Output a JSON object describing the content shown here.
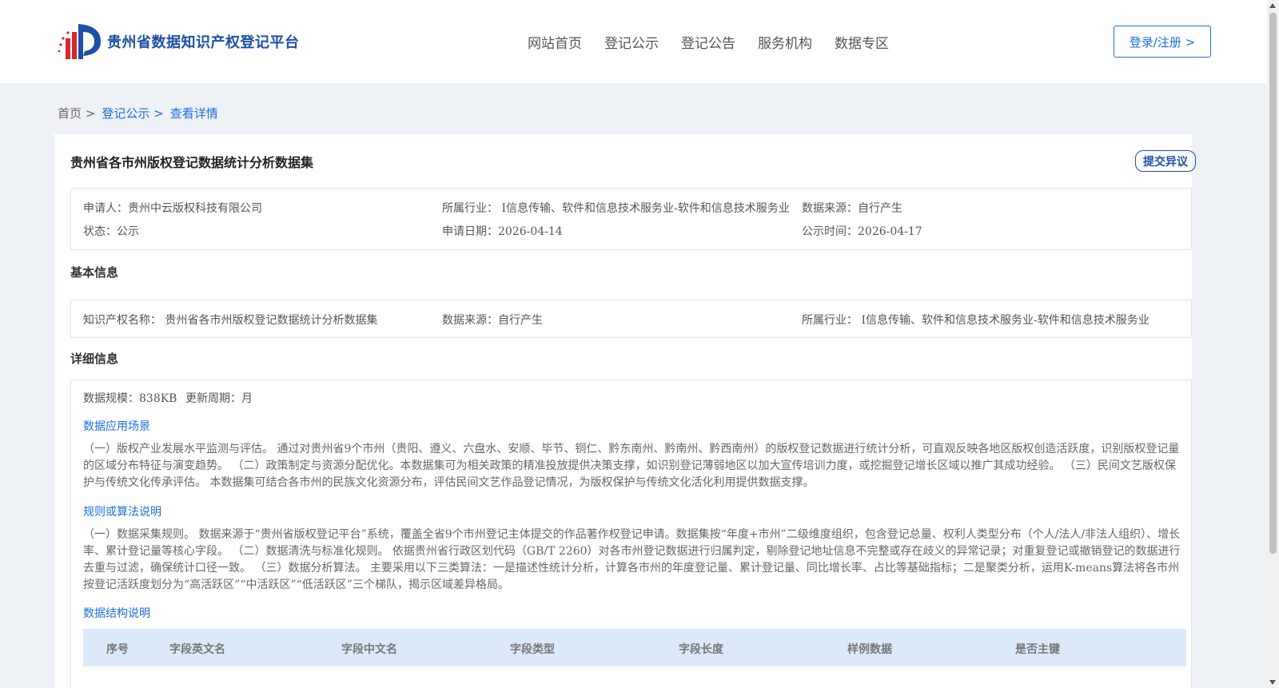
{
  "header": {
    "site_name": "贵州省数据知识产权登记平台",
    "nav": [
      "网站首页",
      "登记公示",
      "登记公告",
      "服务机构",
      "数据专区"
    ],
    "login_label": "登录/注册 >"
  },
  "breadcrumb": {
    "home": "首页 >",
    "level1": "登记公示 >",
    "level2": "查看详情"
  },
  "detail": {
    "title": "贵州省各市州版权登记数据统计分析数据集",
    "objection_label": "提交异议",
    "summary": {
      "applicant": "申请人：贵州中云版权科技有限公司",
      "industry": "所属行业： I信息传输、软件和信息技术服务业-软件和信息技术服务业",
      "source": "数据来源：自行产生",
      "status": "状态：公示",
      "apply_date": "申请日期：2026-04-14",
      "publish_date": "公示时间：2026-04-17"
    },
    "basic": {
      "section_title": "基本信息",
      "name": "知识产权名称： 贵州省各市州版权登记数据统计分析数据集",
      "source": "数据来源：自行产生",
      "industry": "所属行业： I信息传输、软件和信息技术服务业-软件和信息技术服务业"
    },
    "details": {
      "section_title": "详细信息",
      "scale": "数据规模：838KB",
      "cycle": "更新周期：月",
      "scenario_title": "数据应用场景",
      "scenario_text": "（一）版权产业发展水平监测与评估。 通过对贵州省9个市州（贵阳、遵义、六盘水、安顺、毕节、铜仁、黔东南州、黔南州、黔西南州）的版权登记数据进行统计分析，可直观反映各地区版权创造活跃度，识别版权登记量的区域分布特征与演变趋势。 （二）政策制定与资源分配优化。本数据集可为相关政策的精准投放提供决策支撑，如识别登记薄弱地区以加大宣传培训力度，或挖掘登记增长区域以推广其成功经验。 （三）民间文艺版权保护与传统文化传承评估。 本数据集可结合各市州的民族文化资源分布，评估民间文艺作品登记情况，为版权保护与传统文化活化利用提供数据支撑。",
      "rules_title": "规则或算法说明",
      "rules_text": "（一）数据采集规则。 数据来源于“贵州省版权登记平台”系统，覆盖全省9个市州登记主体提交的作品著作权登记申请。数据集按“年度+市州”二级维度组织，包含登记总量、权利人类型分布（个人/法人/非法人组织）、增长率、累计登记量等核心字段。 （二）数据清洗与标准化规则。 依据贵州省行政区划代码（GB/T 2260）对各市州登记数据进行归属判定，剔除登记地址信息不完整或存在歧义的异常记录；对重复登记或撤销登记的数据进行去重与过滤，确保统计口径一致。 （三）数据分析算法。 主要采用以下三类算法：一是描述性统计分析，计算各市州的年度登记量、累计登记量、同比增长率、占比等基础指标；二是聚类分析，运用K-means算法将各市州按登记活跃度划分为“高活跃区”“中活跃区”“低活跃区”三个梯队，揭示区域差异格局。",
      "structure_title": "数据结构说明",
      "table_headers": [
        "序号",
        "字段英文名",
        "字段中文名",
        "字段类型",
        "字段长度",
        "样例数据",
        "是否主键"
      ]
    }
  },
  "colors": {
    "brand": "#1d4fa6",
    "link": "#1d6fe0",
    "table_header_bg": "#dbe9fb",
    "page_bg": "#eef1f6"
  }
}
